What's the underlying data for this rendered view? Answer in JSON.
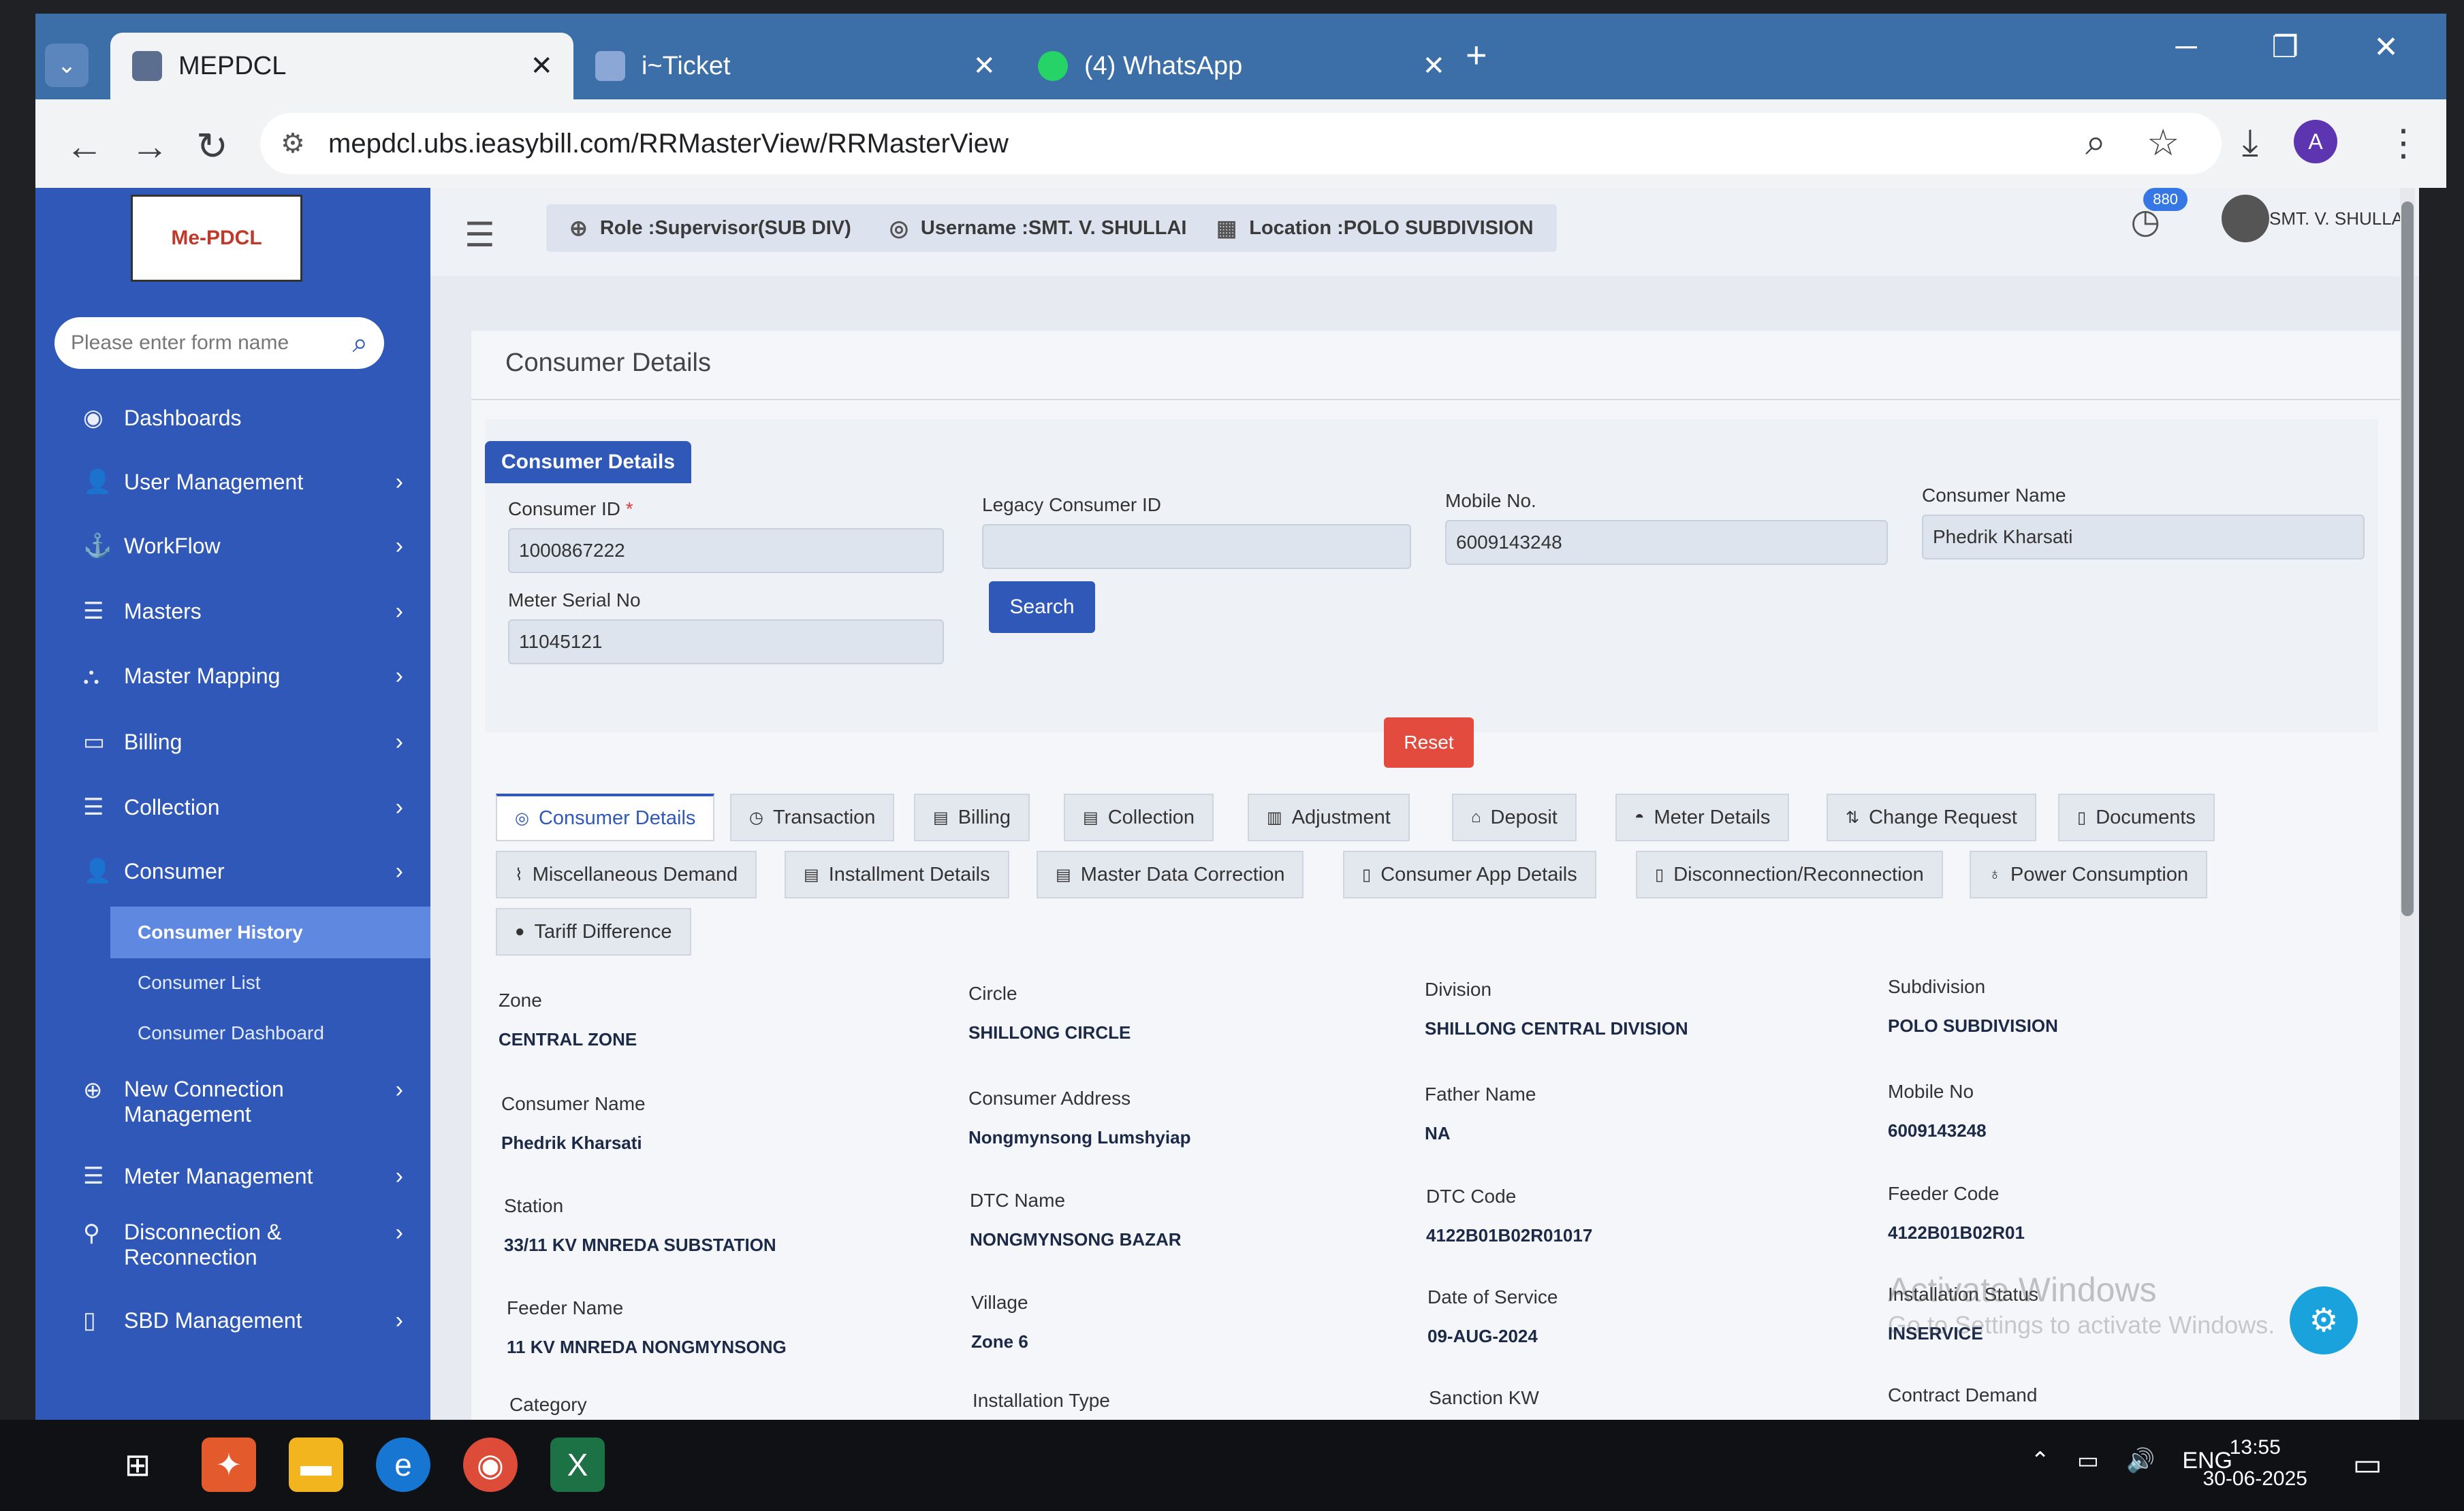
{
  "browser": {
    "tabs": [
      {
        "label": "MEPDCL",
        "active": true
      },
      {
        "label": "i~Ticket",
        "active": false
      },
      {
        "label": "(4) WhatsApp",
        "active": false
      }
    ],
    "new_tab": "+",
    "url": "mepdcl.ubs.ieasybill.com/RRMasterView/RRMasterView",
    "profile_initial": "A"
  },
  "sidebar": {
    "logo_text": "Me-PDCL",
    "search_placeholder": "Please enter form name",
    "items": [
      {
        "label": "Dashboards",
        "icon": "dashboard-icon"
      },
      {
        "label": "User Management",
        "icon": "user-icon"
      },
      {
        "label": "WorkFlow",
        "icon": "anchor-icon"
      },
      {
        "label": "Masters",
        "icon": "list-icon"
      },
      {
        "label": "Master Mapping",
        "icon": "sitemap-icon"
      },
      {
        "label": "Billing",
        "icon": "monitor-icon"
      },
      {
        "label": "Collection",
        "icon": "list-icon"
      },
      {
        "label": "Consumer",
        "icon": "user-icon"
      }
    ],
    "consumer_sub": [
      "Consumer History",
      "Consumer List",
      "Consumer Dashboard"
    ],
    "more_items": [
      {
        "label": "New Connection Management",
        "line1": "New Connection",
        "line2": "Management"
      },
      {
        "label": "Meter Management"
      },
      {
        "label": "Disconnection & Reconnection",
        "line1": "Disconnection &",
        "line2": "Reconnection"
      },
      {
        "label": "SBD Management"
      }
    ]
  },
  "header": {
    "role": "Role :Supervisor(SUB DIV)",
    "username": "Username :SMT. V. SHULLAI",
    "location": "Location :POLO SUBDIVISION",
    "notification_count": "880",
    "user_name": "SMT. V. SHULLAI"
  },
  "card": {
    "title": "Consumer Details",
    "panel_tab": "Consumer Details",
    "fields": {
      "consumer_id": {
        "label": "Consumer ID",
        "required": "*",
        "value": "1000867222"
      },
      "legacy_id": {
        "label": "Legacy Consumer ID",
        "value": ""
      },
      "mobile": {
        "label": "Mobile No.",
        "value": "6009143248"
      },
      "consumer_name": {
        "label": "Consumer Name",
        "value": "Phedrik Kharsati"
      },
      "meter_serial": {
        "label": "Meter Serial No",
        "value": "11045121"
      }
    },
    "search_label": "Search",
    "reset_label": "Reset"
  },
  "detail_tabs": {
    "row1": [
      "Consumer Details",
      "Transaction",
      "Billing",
      "Collection",
      "Adjustment",
      "Deposit",
      "Meter Details",
      "Change Request",
      "Documents"
    ],
    "row2": [
      "Miscellaneous Demand",
      "Installment Details",
      "Master Data Correction",
      "Consumer App Details",
      "Disconnection/Reconnection",
      "Power Consumption"
    ],
    "row3": [
      "Tariff Difference"
    ]
  },
  "details": {
    "zone": {
      "label": "Zone",
      "value": "CENTRAL ZONE"
    },
    "circle": {
      "label": "Circle",
      "value": "SHILLONG CIRCLE"
    },
    "division": {
      "label": "Division",
      "value": "SHILLONG CENTRAL DIVISION"
    },
    "subdivision": {
      "label": "Subdivision",
      "value": "POLO SUBDIVISION"
    },
    "consumer_name": {
      "label": "Consumer Name",
      "value": "Phedrik Kharsati"
    },
    "consumer_address": {
      "label": "Consumer Address",
      "value": "Nongmynsong Lumshyiap"
    },
    "father_name": {
      "label": "Father Name",
      "value": "NA"
    },
    "mobile_no": {
      "label": "Mobile No",
      "value": "6009143248"
    },
    "station": {
      "label": "Station",
      "value": "33/11 KV MNREDA SUBSTATION"
    },
    "dtc_name": {
      "label": "DTC Name",
      "value": "NONGMYNSONG BAZAR"
    },
    "dtc_code": {
      "label": "DTC Code",
      "value": "4122B01B02R01017"
    },
    "feeder_code": {
      "label": "Feeder Code",
      "value": "4122B01B02R01"
    },
    "feeder_name": {
      "label": "Feeder Name",
      "value": "11 KV MNREDA NONGMYNSONG"
    },
    "village": {
      "label": "Village",
      "value": "Zone 6"
    },
    "date_of_service": {
      "label": "Date of Service",
      "value": "09-AUG-2024"
    },
    "installation_status": {
      "label": "Installation Status",
      "value": "INSERVICE"
    },
    "category": {
      "label": "Category"
    },
    "installation_type": {
      "label": "Installation Type"
    },
    "sanction_kw": {
      "label": "Sanction KW"
    },
    "contract_demand": {
      "label": "Contract Demand"
    }
  },
  "watermark": {
    "line1": "Activate Windows",
    "line2": "Go to Settings to activate Windows."
  },
  "taskbar": {
    "lang": "ENG",
    "time": "13:55",
    "date": "30-06-2025"
  }
}
